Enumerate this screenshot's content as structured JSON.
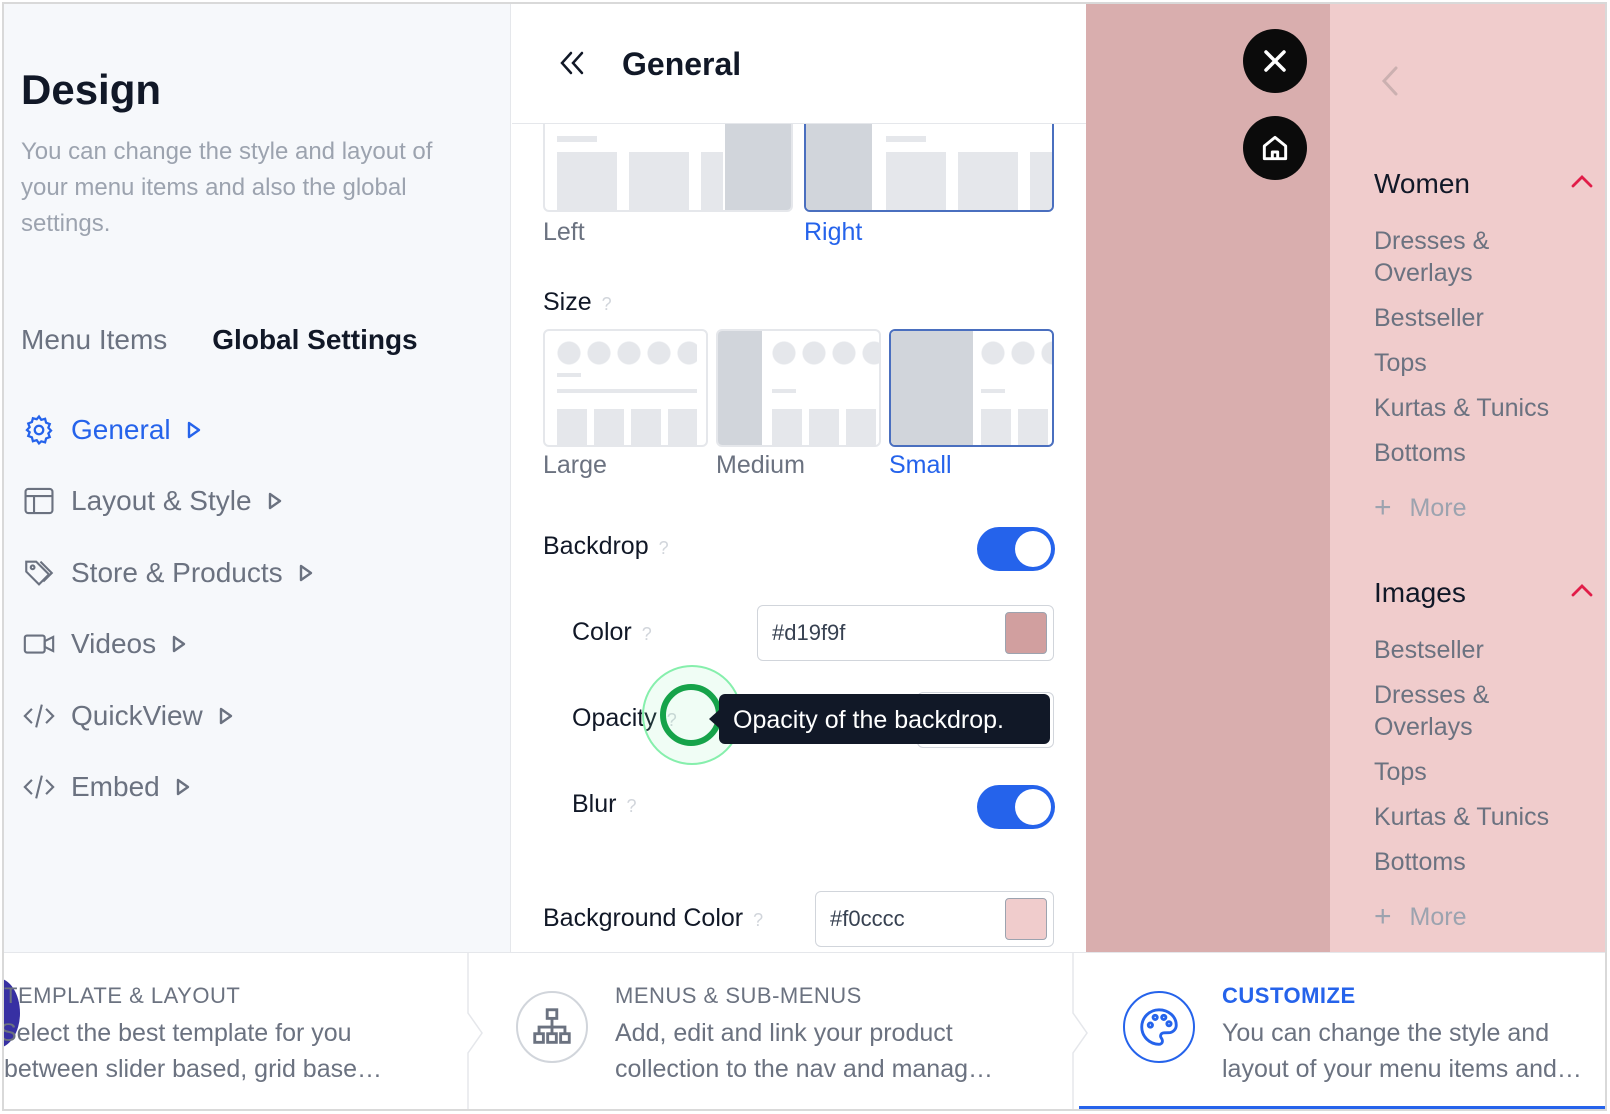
{
  "sidebar": {
    "title": "Design",
    "description": "You can change the style and layout of your menu items and also the global settings.",
    "tabs": {
      "menu_items": "Menu Items",
      "global_settings": "Global Settings"
    },
    "nav": [
      {
        "label": "General",
        "icon": "gear-icon",
        "active": true
      },
      {
        "label": "Layout & Style",
        "icon": "layout-icon"
      },
      {
        "label": "Store & Products",
        "icon": "tags-icon"
      },
      {
        "label": "Videos",
        "icon": "video-icon"
      },
      {
        "label": "QuickView",
        "icon": "code-icon"
      },
      {
        "label": "Embed",
        "icon": "code-icon"
      }
    ]
  },
  "panel": {
    "title": "General",
    "position": {
      "options": [
        "Left",
        "Right"
      ],
      "selected": "Right"
    },
    "size": {
      "label": "Size",
      "options": [
        "Large",
        "Medium",
        "Small"
      ],
      "selected": "Small"
    },
    "backdrop": {
      "label": "Backdrop",
      "enabled": true
    },
    "color": {
      "label": "Color",
      "value": "#d19f9f"
    },
    "opacity": {
      "label": "Opacity",
      "tooltip": "Opacity of the backdrop."
    },
    "blur": {
      "label": "Blur",
      "enabled": true
    },
    "background_color": {
      "label": "Background Color",
      "value": "#f0cccc"
    },
    "help_mark": "?"
  },
  "preview": {
    "groups": [
      {
        "title": "Women",
        "items": [
          "Dresses & Overlays",
          "Bestseller",
          "Tops",
          "Kurtas & Tunics",
          "Bottoms"
        ],
        "more": "More"
      },
      {
        "title": "Images",
        "items": [
          "Bestseller",
          "Dresses & Overlays",
          "Tops",
          "Kurtas & Tunics",
          "Bottoms"
        ],
        "more": "More"
      }
    ],
    "accent": "#e11d48"
  },
  "steps": [
    {
      "title": "TEMPLATE & LAYOUT",
      "line1": "Select the best template for you",
      "line2": "between slider based, grid base…"
    },
    {
      "title": "MENUS & SUB-MENUS",
      "line1": "Add, edit and link your product",
      "line2": "collection to the nav and manag…"
    },
    {
      "title": "CUSTOMIZE",
      "line1": "You can change the style and",
      "line2": "layout of your menu items and…",
      "active": true
    }
  ],
  "colors": {
    "primary": "#2563eb",
    "backdrop": "#d9aeae",
    "menu_bg": "#f0cccc"
  }
}
